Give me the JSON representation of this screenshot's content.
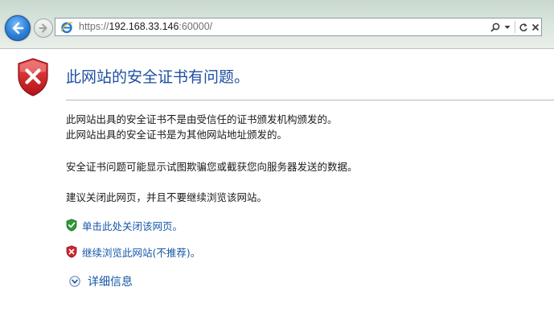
{
  "address_bar": {
    "url_prefix": "https://",
    "url_host": "192.168.33.146",
    "url_suffix": ":60000/"
  },
  "error_page": {
    "title": "此网站的安全证书有问题。",
    "reasons": [
      "此网站出具的安全证书不是由受信任的证书颁发机构颁发的。",
      "此网站出具的安全证书是为其他网站地址颁发的。"
    ],
    "warning": "安全证书问题可能显示试图欺骗您或截获您向服务器发送的数据。",
    "recommendation": "建议关闭此网页，并且不要继续浏览该网站。",
    "close_link": "单击此处关闭该网页。",
    "continue_link": "继续浏览此网站(不推荐)。",
    "details_link": "详细信息"
  },
  "icons": {
    "back": "back-arrow-icon",
    "forward": "forward-arrow-icon",
    "site": "ie-logo-icon",
    "search": "search-icon",
    "dropdown": "chevron-down-icon",
    "refresh": "refresh-icon",
    "stop": "close-icon",
    "shield_error": "shield-error-icon",
    "shield_ok": "shield-check-icon",
    "expand": "expand-circle-icon"
  },
  "colors": {
    "title": "#1f4fa0",
    "link": "#1658a8",
    "shield_red": "#d0262b",
    "shield_green": "#2e9b35"
  }
}
